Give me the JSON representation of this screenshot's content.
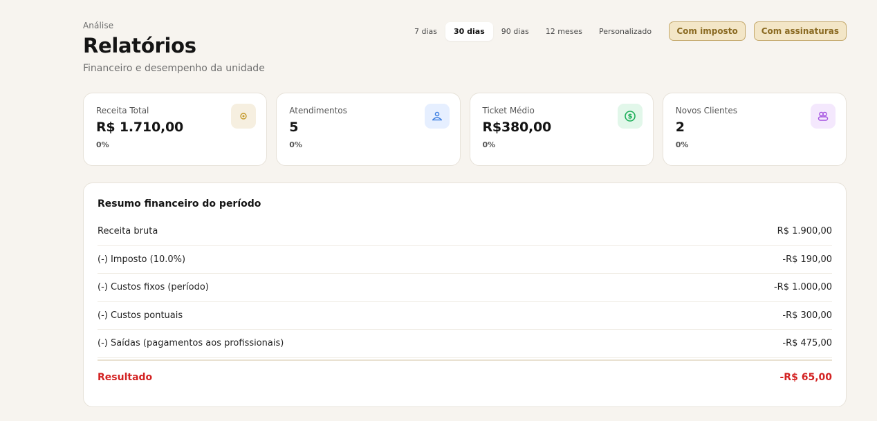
{
  "header": {
    "eyebrow": "Análise",
    "title": "Relatórios",
    "subtitle": "Financeiro e desempenho da unidade"
  },
  "period_tabs": [
    {
      "label": "7 dias",
      "active": false
    },
    {
      "label": "30 dias",
      "active": true
    },
    {
      "label": "90 dias",
      "active": false
    },
    {
      "label": "12 meses",
      "active": false
    },
    {
      "label": "Personalizado",
      "active": false
    }
  ],
  "toggles": {
    "tax_label": "Com imposto",
    "subscriptions_label": "Com assinaturas"
  },
  "kpis": [
    {
      "label": "Receita Total",
      "value": "R$ 1.710,00",
      "delta": "0%",
      "icon": "coin-icon",
      "icon_bg": "#f6efe0",
      "icon_color": "#c49a2c"
    },
    {
      "label": "Atendimentos",
      "value": "5",
      "delta": "0%",
      "icon": "users-icon",
      "icon_bg": "#e6efff",
      "icon_color": "#3b7de0"
    },
    {
      "label": "Ticket Médio",
      "value": "R$380,00",
      "delta": "0%",
      "icon": "dollar-icon",
      "icon_bg": "#e2f7ea",
      "icon_color": "#1eaf5a"
    },
    {
      "label": "Novos Clientes",
      "value": "2",
      "delta": "0%",
      "icon": "people-icon",
      "icon_bg": "#f4e8fd",
      "icon_color": "#a450e0"
    }
  ],
  "summary": {
    "title": "Resumo financeiro do período",
    "rows": [
      {
        "label": "Receita bruta",
        "value": "R$ 1.900,00"
      },
      {
        "label": "(-) Imposto (10.0%)",
        "value": "-R$ 190,00"
      },
      {
        "label": "(-) Custos fixos (período)",
        "value": "-R$ 1.000,00"
      },
      {
        "label": "(-) Custos pontuais",
        "value": "-R$ 300,00"
      },
      {
        "label": "(-) Saídas (pagamentos aos profissionais)",
        "value": "-R$ 475,00"
      }
    ],
    "result_label": "Resultado",
    "result_value": "-R$ 65,00",
    "result_color": "#d32222"
  }
}
